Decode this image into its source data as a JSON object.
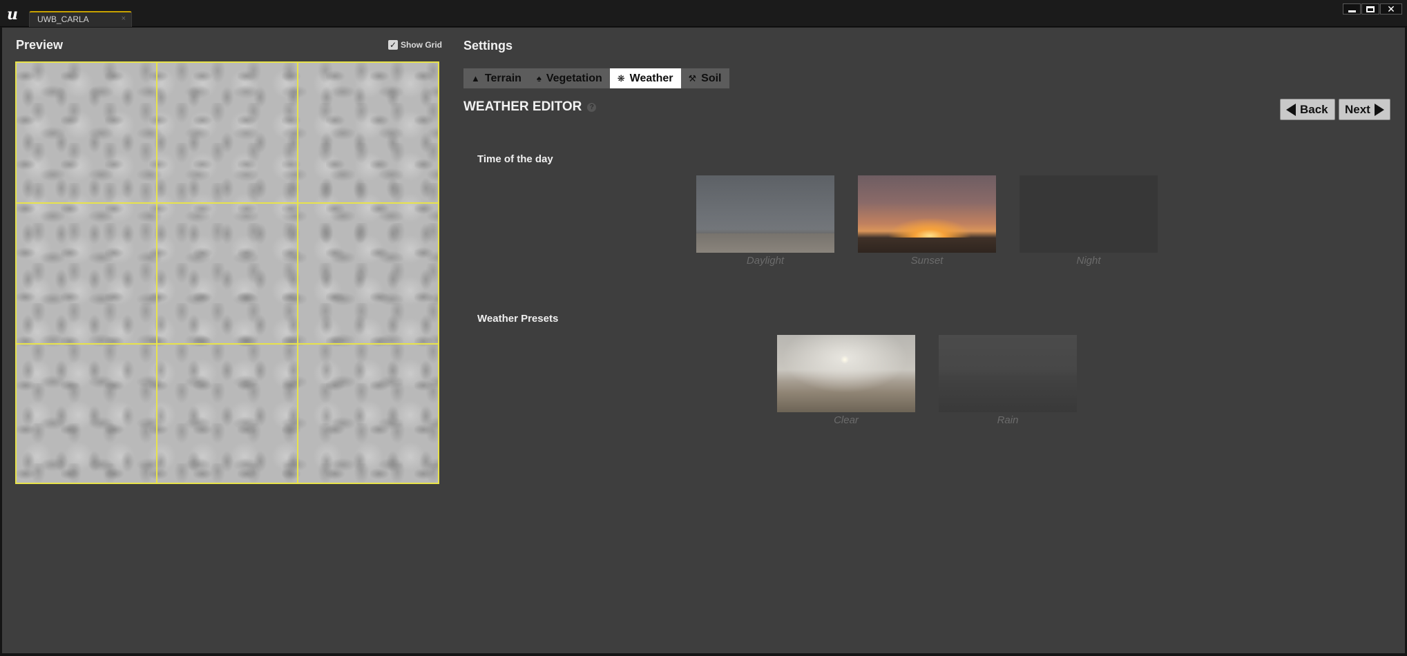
{
  "window": {
    "tab_label": "UWB_CARLA",
    "tab_close": "×",
    "logo_icon": "unreal-engine-logo",
    "controls": [
      "minimize",
      "maximize",
      "close"
    ]
  },
  "preview": {
    "title": "Preview",
    "show_grid_label": "Show Grid",
    "show_grid_checked": true,
    "grid_rows": 3,
    "grid_cols": 3,
    "grid_color": "#e8e34a"
  },
  "settings": {
    "title": "Settings",
    "tabs": [
      {
        "label": "Terrain",
        "icon": "mountain-icon",
        "active": false
      },
      {
        "label": "Vegetation",
        "icon": "trees-icon",
        "active": false
      },
      {
        "label": "Weather",
        "icon": "weather-icon",
        "active": true
      },
      {
        "label": "Soil",
        "icon": "shovel-icon",
        "active": false
      }
    ]
  },
  "editor": {
    "title": "WEATHER EDITOR",
    "help_icon": "help-icon",
    "back_label": "Back",
    "next_label": "Next"
  },
  "time_of_day": {
    "label": "Time of the day",
    "options": [
      "Daylight",
      "Sunset",
      "Night"
    ]
  },
  "weather_presets": {
    "label": "Weather Presets",
    "options": [
      "Clear",
      "Rain"
    ]
  }
}
